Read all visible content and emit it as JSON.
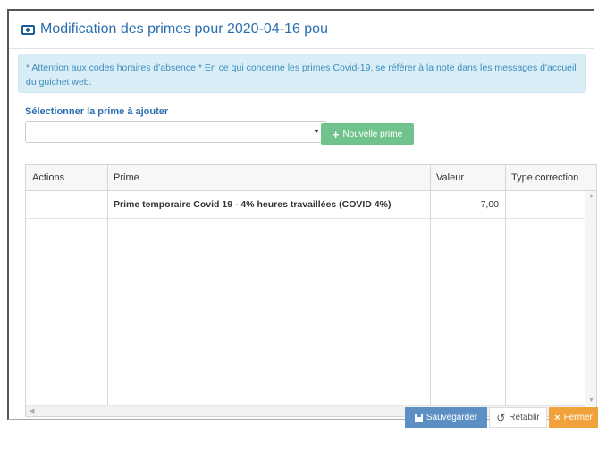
{
  "dialog": {
    "title": "Modification des primes pour 2020-04-16 pou",
    "icon": "money-icon"
  },
  "alert": {
    "text": "* Attention aux codes horaires d'absence * En ce qui concerne les primes Covid-19, se référer à la note dans les messages d'accueil du guichet web."
  },
  "selector": {
    "label": "Sélectionner la prime à ajouter",
    "value": "",
    "new_button": "Nouvelle prime"
  },
  "table": {
    "columns": [
      "Actions",
      "Prime",
      "Valeur",
      "Type correction"
    ],
    "rows": [
      {
        "actions": "",
        "prime": "Prime temporaire Covid 19 - 4% heures travaillées (COVID 4%)",
        "valeur": "7,00",
        "type_correction": ""
      }
    ]
  },
  "footer": {
    "save": "Sauvegarder",
    "reset": "Rétablir",
    "close": "Fermer"
  },
  "colors": {
    "title_blue": "#2a6eb1",
    "alert_bg": "#d9edf7",
    "success_green": "#71c38d",
    "save_blue": "#5d8fc4",
    "close_orange": "#f2a23b"
  }
}
